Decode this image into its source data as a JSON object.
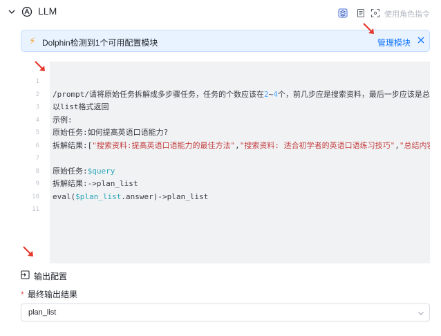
{
  "header": {
    "title": "LLM",
    "role_command_label": "使用角色指令",
    "icons": [
      "chevron-down-icon",
      "llm-brain-icon",
      "layers-icon",
      "document-icon",
      "expand-icon"
    ]
  },
  "banner": {
    "text": "Dolphin检测到1个可用配置模块",
    "link_label": "管理模块",
    "link_color": "#1677ff",
    "background_color": "#e9f3ff"
  },
  "editor": {
    "line_numbers": [
      "1",
      "2",
      "3",
      "4",
      "5",
      "6",
      "7",
      "8",
      "9",
      "10",
      "11"
    ],
    "lines": [
      {
        "segments": []
      },
      {
        "segments": [
          {
            "t": "/prompt/请将原始任务拆解成多步骤任务，任务的个数应该在",
            "c": "plain"
          },
          {
            "t": "2",
            "c": "num"
          },
          {
            "t": "~",
            "c": "plain"
          },
          {
            "t": "4",
            "c": "num"
          },
          {
            "t": "个，前几步应是搜索资料，最后一步应该是总结内容",
            "c": "plain"
          }
        ]
      },
      {
        "segments": [
          {
            "t": "以list格式返回",
            "c": "plain"
          }
        ]
      },
      {
        "segments": [
          {
            "t": "示例:",
            "c": "plain"
          }
        ]
      },
      {
        "segments": [
          {
            "t": "原始任务:如何提高英语口语能力?",
            "c": "plain"
          }
        ]
      },
      {
        "segments": [
          {
            "t": "拆解结果:[",
            "c": "plain"
          },
          {
            "t": "\"搜索资料:提高英语口语能力的最佳方法\"",
            "c": "str"
          },
          {
            "t": ",",
            "c": "plain"
          },
          {
            "t": "\"搜索资料: 适合初学者的英语口语练习技巧\"",
            "c": "str"
          },
          {
            "t": ",",
            "c": "plain"
          },
          {
            "t": "\"总结内容\"",
            "c": "str"
          }
        ]
      },
      {
        "segments": []
      },
      {
        "segments": [
          {
            "t": "原始任务:",
            "c": "plain"
          },
          {
            "t": "$query",
            "c": "var"
          }
        ]
      },
      {
        "segments": [
          {
            "t": "拆解结果:->plan_list",
            "c": "plain"
          }
        ]
      },
      {
        "segments": [
          {
            "t": "eval(",
            "c": "plain"
          },
          {
            "t": "$plan_list",
            "c": "var"
          },
          {
            "t": ".answer)->plan_list",
            "c": "plain"
          }
        ]
      },
      {
        "segments": []
      }
    ]
  },
  "output": {
    "section_title": "输出配置",
    "final_result_label": "最终输出结果",
    "required_mark": "*",
    "selected_value": "plan_list"
  },
  "colors": {
    "annotation_arrow": "#e5362b",
    "required": "#e5484d"
  }
}
